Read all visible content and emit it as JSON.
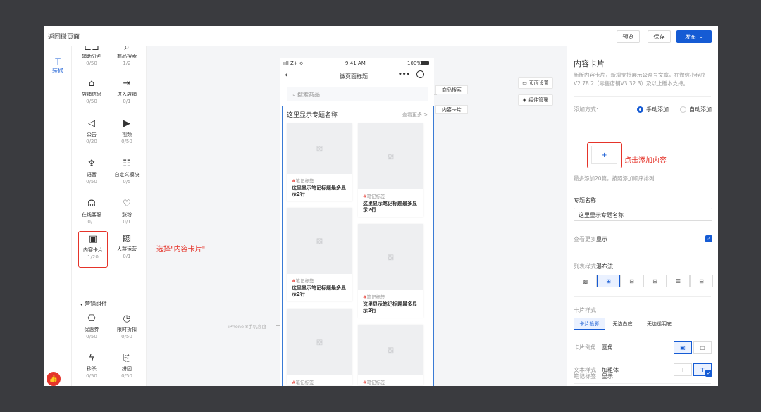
{
  "topbar": {
    "back": "返回微页面",
    "preview": "预览",
    "save": "保存",
    "publish": "发布"
  },
  "rail": {
    "decorate": "装修"
  },
  "components": [
    {
      "label": "辅助分割",
      "count": "0/50"
    },
    {
      "label": "商品搜索",
      "count": "1/2"
    },
    {
      "label": "店铺信息",
      "count": "0/50"
    },
    {
      "label": "进入店铺",
      "count": "0/1"
    },
    {
      "label": "公告",
      "count": "0/20"
    },
    {
      "label": "视频",
      "count": "0/50"
    },
    {
      "label": "语音",
      "count": "0/50"
    },
    {
      "label": "自定义模块",
      "count": "0/5"
    },
    {
      "label": "在线客服",
      "count": "0/1"
    },
    {
      "label": "涨粉",
      "count": "0/1"
    },
    {
      "label": "内容卡片",
      "count": "1/20"
    },
    {
      "label": "人群运营",
      "count": "0/1"
    }
  ],
  "marketing": {
    "title": "营销组件",
    "items": [
      {
        "label": "优惠券",
        "count": "0/50"
      },
      {
        "label": "限时折扣",
        "count": "0/50"
      },
      {
        "label": "秒杀",
        "count": "0/50"
      },
      {
        "label": "拼团",
        "count": "0/50"
      }
    ]
  },
  "annotations": {
    "select": "选择\"内容卡片\"",
    "add": "点击添加内容"
  },
  "phone": {
    "status_left": "ııll Z+ ≎",
    "status_time": "9:41 AM",
    "status_battery": "100%",
    "nav_title": "微页面标题",
    "search_placeholder": "搜索商品",
    "list_title": "这里显示专题名称",
    "list_more": "查看更多 >",
    "card_tag": "笔记标签",
    "card_title": "这里显示笔记标题最多显示2行"
  },
  "float_labels": {
    "search": "商品搜索",
    "card": "内容卡片"
  },
  "side_buttons": {
    "page_settings": "页面设置",
    "component_manage": "组件管理"
  },
  "iphone_label": "iPhone 8手机高度",
  "props": {
    "title": "内容卡片",
    "desc": "新版内容卡片，新增支持展示公众号文章，在微信小程序V2.78.2（零售店铺V3.32.3）及以上版本支持。",
    "add_method": "添加方式:",
    "manual": "手动添加",
    "auto": "自动添加",
    "add_hint": "最多添加20篇，按照添加顺序排列",
    "topic_name_label": "专题名称",
    "topic_name_value": "这里显示专题名称",
    "view_more_label": "查看更多",
    "view_more_value": "显示",
    "list_style_label": "列表样式",
    "list_style_value": "瀑布流",
    "card_style_label": "卡片样式",
    "card_styles": [
      "卡片投影",
      "无边白底",
      "无边透明底"
    ],
    "corner_label": "卡片倒角",
    "corner_value": "圆角",
    "text_style_label": "文本样式",
    "text_style_value": "加粗体",
    "note_tag_label": "笔记标签",
    "note_tag_value": "显示"
  },
  "colors": {
    "accent": "#155bd4",
    "annotation": "#e5342a"
  }
}
